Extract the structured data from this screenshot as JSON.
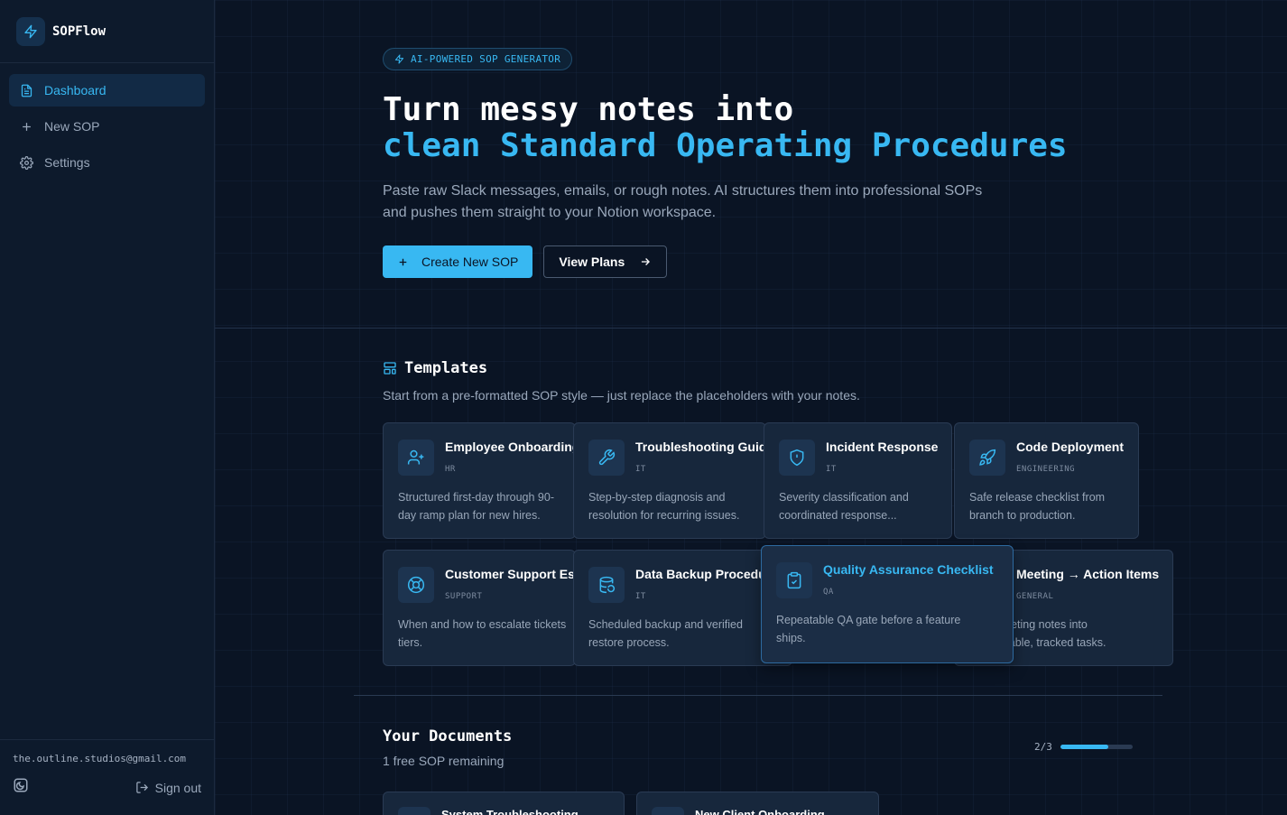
{
  "brand": {
    "name": "SOPFlow"
  },
  "sidebar": {
    "items": [
      {
        "label": "Dashboard",
        "icon": "file-text-icon",
        "active": true
      },
      {
        "label": "New SOP",
        "icon": "plus-icon",
        "active": false
      },
      {
        "label": "Settings",
        "icon": "gear-icon",
        "active": false
      }
    ],
    "footer": {
      "email": "the.outline.studios@gmail.com",
      "signout_label": "Sign out"
    }
  },
  "hero": {
    "badge": "AI-POWERED SOP GENERATOR",
    "title_line1": "Turn messy notes into",
    "title_line2": "clean Standard Operating Procedures",
    "description": "Paste raw Slack messages, emails, or rough notes. AI structures them into professional SOPs and pushes them straight to your Notion workspace.",
    "primary_cta": "Create New SOP",
    "secondary_cta": "View Plans"
  },
  "templates": {
    "title": "Templates",
    "subtitle": "Start from a pre-formatted SOP style — just replace the placeholders with your notes.",
    "items": [
      {
        "title": "Employee Onboarding",
        "tag": "HR",
        "desc": "Structured first-day through 90-day ramp plan for new hires.",
        "icon": "user-plus-icon"
      },
      {
        "title": "Troubleshooting Guide",
        "tag": "IT",
        "desc": "Step-by-step diagnosis and resolution for recurring issues.",
        "icon": "wrench-icon"
      },
      {
        "title": "Incident Response",
        "tag": "IT",
        "desc": "Severity classification and coordinated response...",
        "icon": "shield-alert-icon"
      },
      {
        "title": "Code Deployment",
        "tag": "ENGINEERING",
        "desc": "Safe release checklist from branch to production.",
        "icon": "rocket-icon"
      },
      {
        "title": "Customer Support Escalation",
        "tag": "SUPPORT",
        "desc": "When and how to escalate tickets tiers.",
        "icon": "life-buoy-icon"
      },
      {
        "title": "Data Backup Procedure",
        "tag": "IT",
        "desc": "Scheduled backup and verified restore process.",
        "icon": "database-backup-icon"
      },
      {
        "title": "Quality Assurance Checklist",
        "tag": "QA",
        "desc": "Repeatable QA gate before a feature ships.",
        "icon": "clipboard-check-icon"
      },
      {
        "title": "Meeting → Action Items",
        "tag": "GENERAL",
        "desc": "Turn meeting notes into accountable, tracked tasks.",
        "icon": "list-checks-icon"
      }
    ]
  },
  "documents": {
    "title": "Your Documents",
    "subtitle": "1 free SOP remaining",
    "quota_text": "2/3",
    "quota_fraction": 0.667,
    "items": [
      {
        "title": "System Troubleshooting"
      },
      {
        "title": "New Client Onboarding"
      }
    ]
  },
  "colors": {
    "accent": "#38b8f2",
    "background": "#0a1424",
    "sidebar": "#0d1a2c",
    "card": "#17273c"
  }
}
